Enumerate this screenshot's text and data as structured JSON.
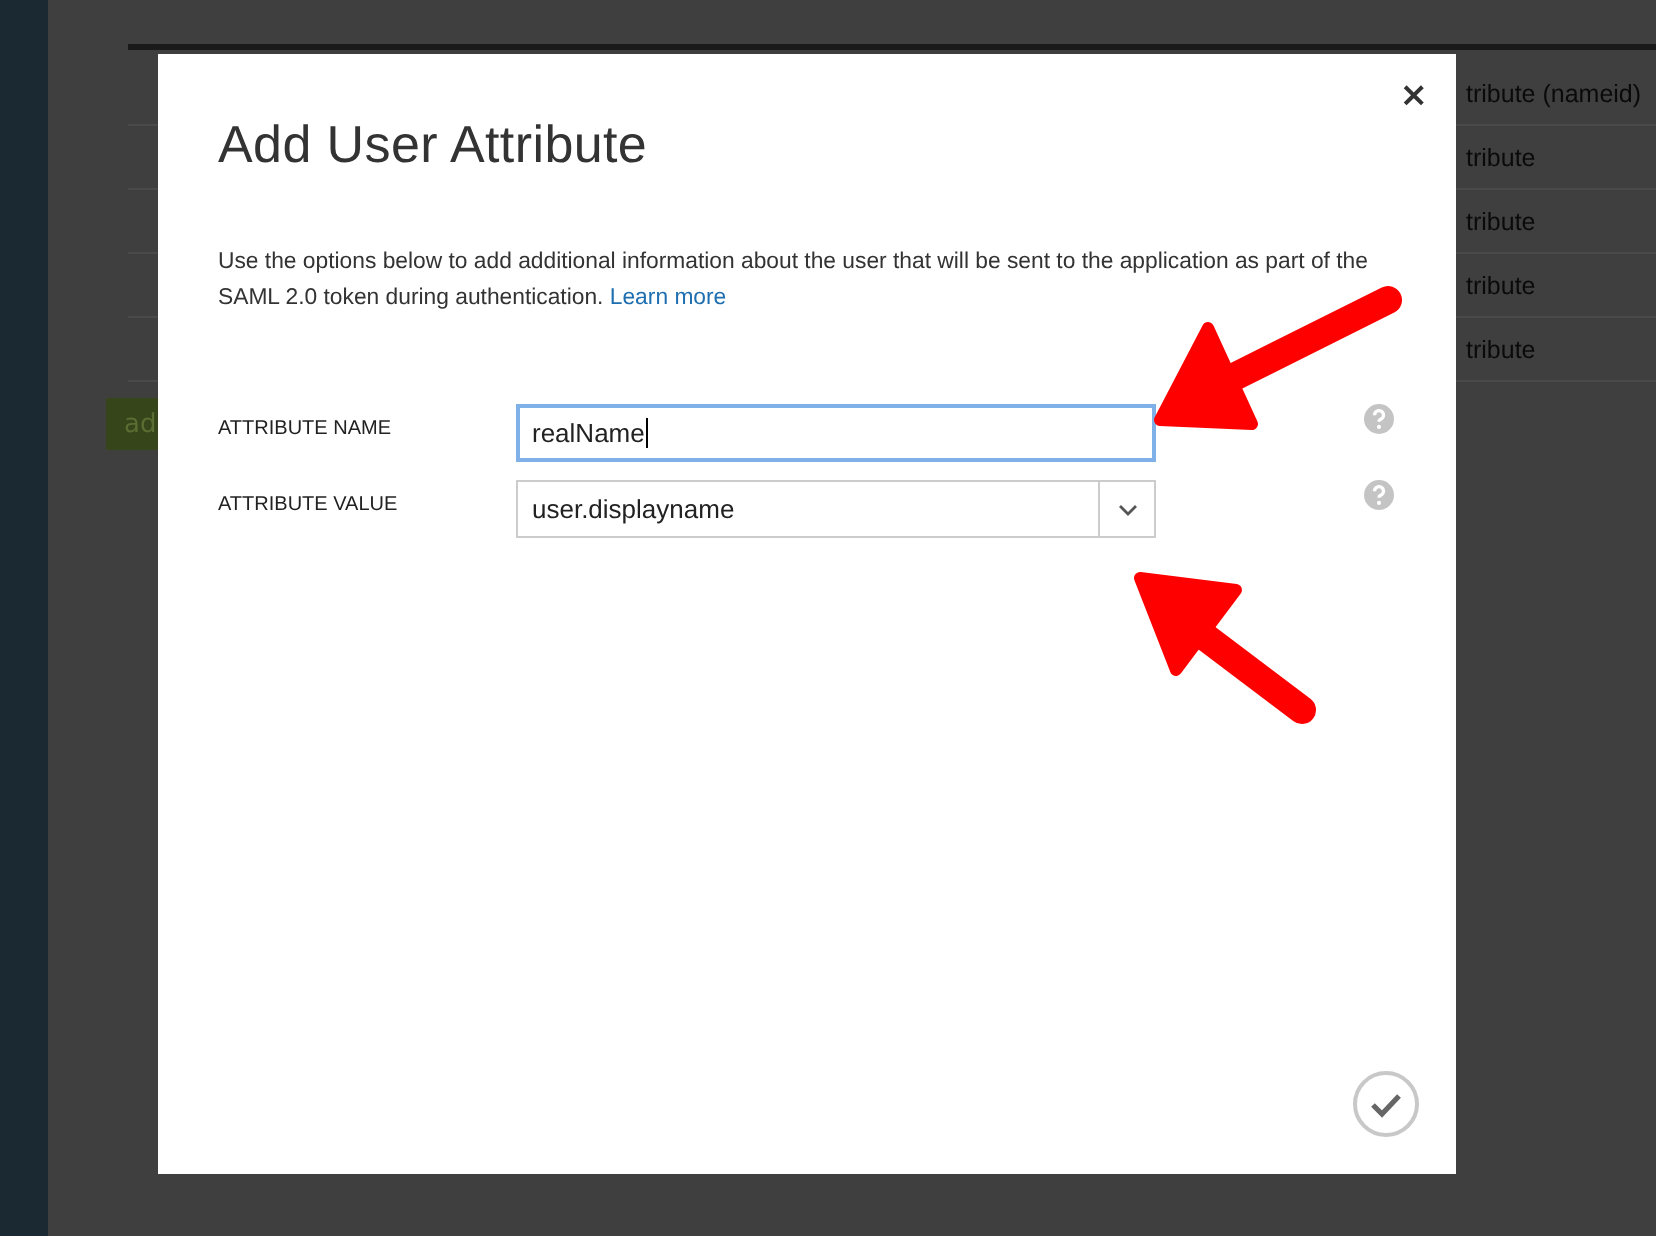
{
  "background": {
    "rows": [
      {
        "type": "tribute (nameid)"
      },
      {
        "type": "tribute"
      },
      {
        "type": "tribute"
      },
      {
        "type": "tribute"
      },
      {
        "type": "tribute"
      }
    ],
    "button": "ad"
  },
  "dialog": {
    "title": "Add User Attribute",
    "description": "Use the options below to add additional information about the user that will be sent to the application as part of the SAML 2.0 token during authentication.",
    "link": "Learn more",
    "fields": [
      {
        "kind": "text",
        "label": "ATTRIBUTE NAME",
        "value": "realName",
        "focused": true
      },
      {
        "kind": "select",
        "label": "ATTRIBUTE VALUE",
        "value": "user.displayname",
        "focused": false
      }
    ],
    "close": "×"
  }
}
